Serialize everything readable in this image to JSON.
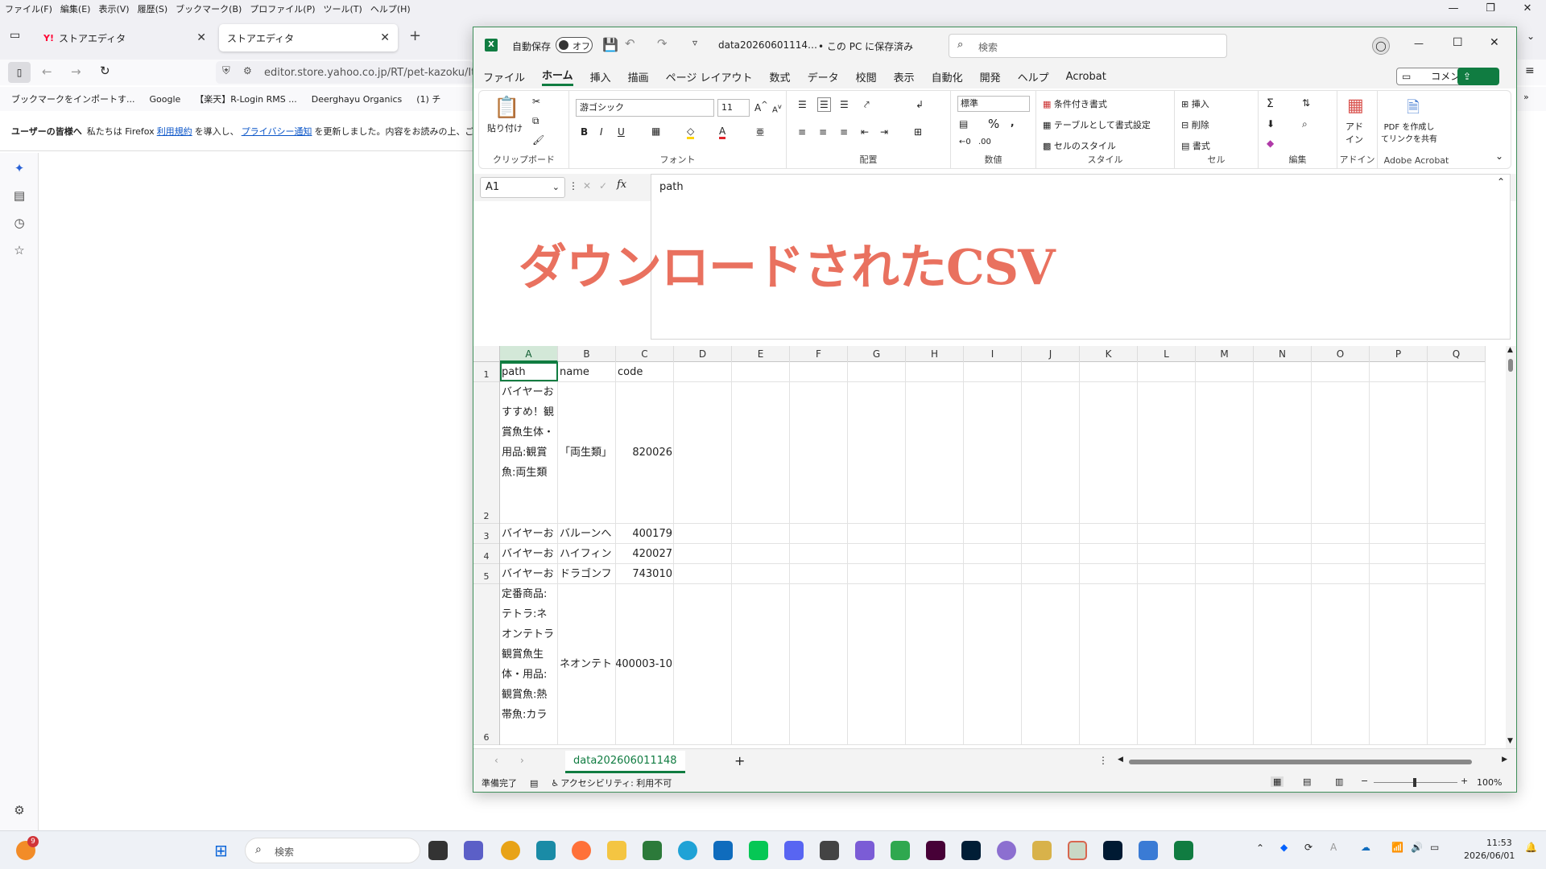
{
  "firefox": {
    "menubar": [
      "ファイル(F)",
      "編集(E)",
      "表示(V)",
      "履歴(S)",
      "ブックマーク(B)",
      "プロファイル(P)",
      "ツール(T)",
      "ヘルプ(H)"
    ],
    "tabs": [
      {
        "label": "ストアエディタ",
        "icon_text": "Y!"
      },
      {
        "label": "ストアエディタ"
      }
    ],
    "url": "editor.store.yahoo.co.jp/RT/pet-kazoku/Ite",
    "bookmarks": [
      "ブックマークをインポートす...",
      "Google",
      "【楽天】R-Login RMS ...",
      "Deerghayu Organics",
      "(1) チ"
    ],
    "notice": {
      "prefix": "ユーザーの皆様へ",
      "text1": "私たちは Firefox",
      "link1": "利用規約",
      "text2": "を導入し、",
      "link2": "プライバシー通知",
      "text3": "を更新しました。内容をお読みの上、ご承諾願い"
    }
  },
  "excel": {
    "autosave_label": "自動保存",
    "autosave_state": "オフ",
    "filename": "data20260601114…",
    "save_status": "• この PC に保存済み",
    "search_placeholder": "検索",
    "menu": [
      "ファイル",
      "ホーム",
      "挿入",
      "描画",
      "ページ レイアウト",
      "数式",
      "データ",
      "校閲",
      "表示",
      "自動化",
      "開発",
      "ヘルプ",
      "Acrobat"
    ],
    "comment_label": "コメント",
    "share_label": "共有",
    "ribbon": {
      "paste": "貼り付け",
      "clipboard": "クリップボード",
      "font_name": "游ゴシック",
      "font_size": "11",
      "font_group": "フォント",
      "align_group": "配置",
      "number_format": "標準",
      "number_group": "数値",
      "cond_format": "条件付き書式",
      "table_format": "テーブルとして書式設定",
      "cell_style": "セルのスタイル",
      "style_group": "スタイル",
      "insert": "挿入",
      "delete": "削除",
      "format": "書式",
      "cells_group": "セル",
      "edit_group": "編集",
      "addin": "アド\nイン",
      "addin_group": "アドイン",
      "pdf_create": "PDF を作成し\nてリンクを共有",
      "acrobat_group": "Adobe Acrobat"
    },
    "namebox": "A1",
    "formula": "path",
    "overlay_title": "ダウンロードされたCSV",
    "columns": [
      "A",
      "B",
      "C",
      "D",
      "E",
      "F",
      "G",
      "H",
      "I",
      "J",
      "K",
      "L",
      "M",
      "N",
      "O",
      "P",
      "Q"
    ],
    "rows": [
      {
        "num": "1",
        "a": "path",
        "b": "name",
        "c": "code"
      },
      {
        "num": "2",
        "a": "バイヤーおすすめ！観賞魚生体・用品:観賞魚:両生類",
        "b": "「両生類」",
        "c": "820026"
      },
      {
        "num": "3",
        "a": "バイヤーお",
        "b": "バルーンへ",
        "c": "400179"
      },
      {
        "num": "4",
        "a": "バイヤーお",
        "b": "ハイフィン",
        "c": "420027"
      },
      {
        "num": "5",
        "a": "バイヤーお",
        "b": "ドラゴンフ",
        "c": "743010"
      },
      {
        "num": "6",
        "a": "定番商品:テトラ:ネオンテトラ観賞魚生体・用品:観賞魚:熱帯魚:カラ",
        "b": "ネオンテト",
        "c": "400003-10"
      }
    ],
    "sheet_tab": "data202606011148",
    "status_ready": "準備完了",
    "status_access": "アクセシビリティ: 利用不可",
    "zoom": "100%"
  },
  "taskbar": {
    "search_placeholder": "検索",
    "time": "11:53",
    "date": "2026/06/01",
    "notification_count": "9"
  },
  "colors": {
    "excel_green": "#107c41",
    "overlay_red": "#e9715f"
  }
}
